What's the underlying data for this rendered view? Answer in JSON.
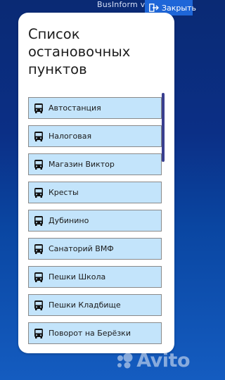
{
  "topbar": {
    "app_name": "BusInform v",
    "close_label": "Закрыть",
    "close_icon": "exit-icon"
  },
  "card": {
    "title": "Список остановочных пунктов"
  },
  "stops": [
    {
      "label": "Автостанция",
      "icon": "bus-icon"
    },
    {
      "label": "Налоговая",
      "icon": "bus-icon"
    },
    {
      "label": "Магазин Виктор",
      "icon": "bus-icon"
    },
    {
      "label": "Кресты",
      "icon": "bus-icon"
    },
    {
      "label": "Дубинино",
      "icon": "bus-icon"
    },
    {
      "label": "Санаторий ВМФ",
      "icon": "bus-icon"
    },
    {
      "label": "Пешки Школа",
      "icon": "bus-icon"
    },
    {
      "label": "Пешки Кладбище",
      "icon": "bus-icon"
    },
    {
      "label": "Поворот на Берёзки",
      "icon": "bus-icon"
    }
  ],
  "watermark": {
    "text": "Avito"
  },
  "colors": {
    "background_top": "#0a2a74",
    "background_bottom": "#145cc0",
    "item_fill": "#c3e4fb",
    "item_border": "#8a8a8a",
    "close_button": "#1e66d8",
    "scrollbar": "#3a3f8f"
  }
}
